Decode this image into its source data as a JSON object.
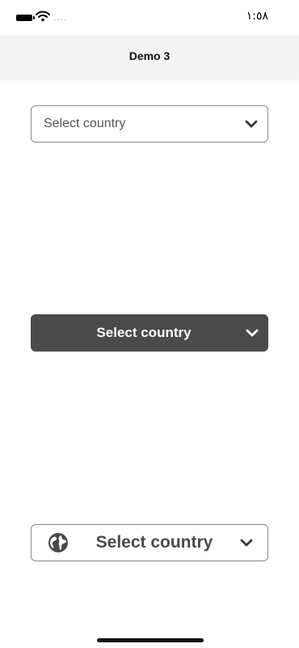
{
  "status_bar": {
    "time": "١:٥٨",
    "signal_dots": "....",
    "icons": [
      "battery-icon",
      "wifi-icon"
    ]
  },
  "nav": {
    "title": "Demo 3"
  },
  "dropdowns": [
    {
      "label": "Select country",
      "style": "outlined",
      "icon": "chevron-down-icon"
    },
    {
      "label": "Select country",
      "style": "filled-dark",
      "icon": "chevron-down-icon"
    },
    {
      "label": "Select country",
      "style": "outlined-with-globe",
      "leading_icon": "globe-icon",
      "icon": "chevron-down-icon"
    }
  ],
  "colors": {
    "dark_fill": "#4a4a4a",
    "border": "#8a8a8a",
    "nav_bg": "#f3f3f3"
  }
}
